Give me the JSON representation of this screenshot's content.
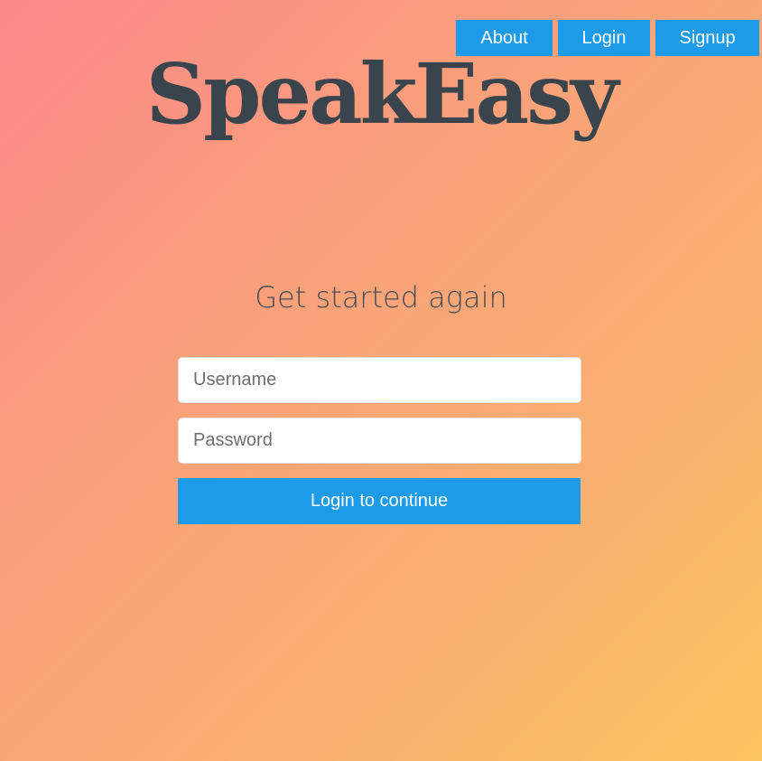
{
  "nav": {
    "about_label": "About",
    "login_label": "Login",
    "signup_label": "Signup"
  },
  "brand": {
    "logo_text": "SpeakEasy"
  },
  "main": {
    "subtitle": "Get started again",
    "username_placeholder": "Username",
    "username_value": "",
    "password_placeholder": "Password",
    "password_value": "",
    "submit_label": "Login to continue"
  },
  "colors": {
    "accent": "#1e9be8",
    "text_dark": "#3a444d",
    "gradient_start": "#fb8789",
    "gradient_end": "#fcc45e"
  }
}
